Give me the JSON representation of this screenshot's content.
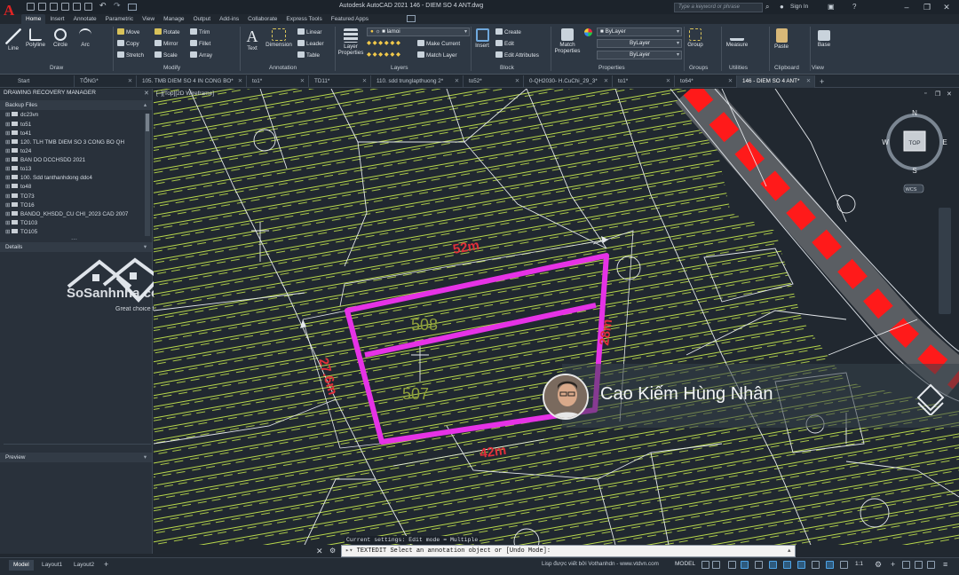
{
  "titlebar": {
    "app_title": "Autodesk AutoCAD 2021    146 - DIEM SO 4 ANT.dwg",
    "search_placeholder": "Type a keyword or phrase",
    "sign_in": "Sign In"
  },
  "ribbon_tabs": [
    "Home",
    "Insert",
    "Annotate",
    "Parametric",
    "View",
    "Manage",
    "Output",
    "Add-ins",
    "Collaborate",
    "Express Tools",
    "Featured Apps"
  ],
  "ribbon": {
    "draw": {
      "title": "Draw",
      "line": "Line",
      "polyline": "Polyline",
      "circle": "Circle",
      "arc": "Arc"
    },
    "modify": {
      "title": "Modify",
      "items": [
        "Move",
        "Rotate",
        "Trim",
        "Copy",
        "Mirror",
        "Fillet",
        "Stretch",
        "Scale",
        "Array"
      ]
    },
    "annotation": {
      "title": "Annotation",
      "text": "Text",
      "dimension": "Dimension",
      "linear": "Linear",
      "leader": "Leader",
      "table": "Table"
    },
    "layers": {
      "title": "Layers",
      "layer_properties": "Layer Properties",
      "current_layer": "lamoi",
      "make_current": "Make Current",
      "match_layer": "Match Layer"
    },
    "block": {
      "title": "Block",
      "insert": "Insert",
      "create": "Create",
      "edit": "Edit",
      "edit_attributes": "Edit Attributes"
    },
    "properties": {
      "title": "Properties",
      "match_properties": "Match Properties",
      "color": "ByLayer",
      "linetype": "ByLayer",
      "lineweight": "ByLayer"
    },
    "groups": {
      "title": "Groups",
      "group": "Group"
    },
    "utilities": {
      "title": "Utilities",
      "measure": "Measure"
    },
    "clipboard": {
      "title": "Clipboard",
      "paste": "Paste"
    },
    "view": {
      "title": "View",
      "base": "Base"
    }
  },
  "doc_tabs": [
    {
      "label": "Start",
      "active": false
    },
    {
      "label": "TỔNG*",
      "active": false
    },
    {
      "label": "105. TMB DIEM SO 4 IN CONG BO*",
      "active": false
    },
    {
      "label": "to1*",
      "active": false
    },
    {
      "label": "TD11*",
      "active": false
    },
    {
      "label": "110. sdd trunglapthuong 2*",
      "active": false
    },
    {
      "label": "to52*",
      "active": false
    },
    {
      "label": "0-QH2030- H.CuChi_29_3*",
      "active": false
    },
    {
      "label": "to1*",
      "active": false
    },
    {
      "label": "to64*",
      "active": false
    },
    {
      "label": "146 - DIEM SO 4 ANT*",
      "active": true
    }
  ],
  "palette": {
    "title": "DRAWING RECOVERY MANAGER",
    "backup_files_header": "Backup Files",
    "files": [
      "dc23vn",
      "to51",
      "to41",
      "120. TLH TMB DIEM SO 3 CONG BO QH",
      "to24",
      "BAN DO DCCHSDD 2021",
      "to13",
      "100. Sdd tanthanhdong ddc4",
      "to48",
      "TO73",
      "TO16",
      "BANDO_KHSDD_CU CHI_2023 CAD 2007",
      "TO103",
      "TO105"
    ],
    "details_header": "Details",
    "preview_header": "Preview"
  },
  "viewport": {
    "label": "[–][Top][2D Wireframe]",
    "parcel_labels": [
      "508",
      "507"
    ],
    "dimensions": [
      "52m",
      "28m",
      "27.6m",
      "42m"
    ],
    "viewcube": {
      "top": "TOP",
      "n": "N",
      "s": "S",
      "e": "E",
      "w": "W",
      "wcs": "WCS"
    }
  },
  "watermark": {
    "brand": "SoSanhnha.com",
    "tagline": "Great choice for you"
  },
  "overlay": {
    "name": "Cao Kiếm Hùng Nhân"
  },
  "command": {
    "history": "Current settings: Edit mode = Multiple",
    "prompt": "TEXTEDIT Select an annotation object or [Undo Mode]:"
  },
  "statusbar": {
    "layout_tabs": [
      "Model",
      "Layout1",
      "Layout2"
    ],
    "message": "Lisp được viết bởi Vothanhdn - www.vtdvn.com",
    "mode": "MODEL",
    "scale": "1:1"
  },
  "colors": {
    "parcel": "#e632e6",
    "dimension": "#e0303a",
    "hatch": "#b8d84a",
    "road_dash": "#ff1a1a",
    "accent": "#3f8fd8"
  }
}
